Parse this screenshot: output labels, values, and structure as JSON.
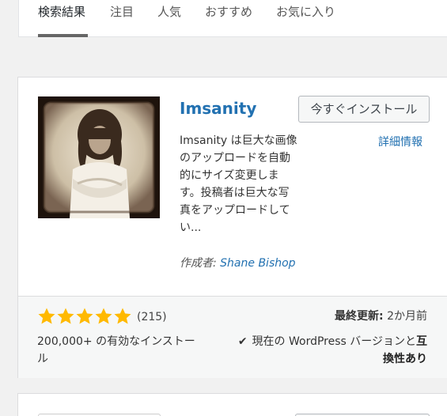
{
  "tabs": [
    {
      "label": "検索結果",
      "active": true
    },
    {
      "label": "注目",
      "active": false
    },
    {
      "label": "人気",
      "active": false
    },
    {
      "label": "おすすめ",
      "active": false
    },
    {
      "label": "お気に入り",
      "active": false
    }
  ],
  "plugin": {
    "name": "Imsanity",
    "install_label": "今すぐインストール",
    "details_label": "詳細情報",
    "description_lines": [
      "Imsanity は巨大な画像",
      "のアップロードを自動",
      "的にサイズ変更しま",
      "す。投稿者は巨大な写",
      "真をアップロードして",
      "い..."
    ],
    "author_prefix": "作成者:",
    "author_name": "Shane Bishop",
    "rating_stars": 5,
    "rating_count": "(215)",
    "installs_lines": [
      "200,000+ の有効なインストー",
      "ル"
    ],
    "last_updated_label": "最終更新:",
    "last_updated_value": "2か月前",
    "compat_text": "現在の WordPress バージョンと",
    "compat_bold_1": "互",
    "compat_bold_2": "換性あり"
  },
  "colors": {
    "link": "#2271b1",
    "star": "#ffb900",
    "tab_underline": "#666666"
  },
  "icons": {
    "star": "star-filled-icon",
    "check": "checkmark-icon"
  }
}
